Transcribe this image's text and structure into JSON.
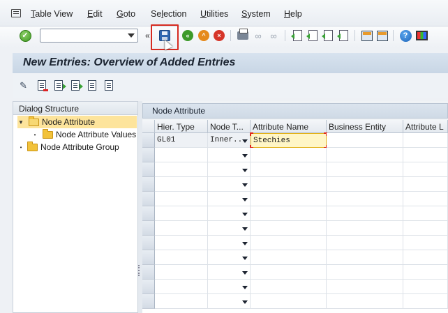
{
  "menubar": {
    "items": [
      {
        "label": "Table View",
        "u": "T",
        "rest": "able View"
      },
      {
        "label": "Edit",
        "u": "E",
        "rest": "dit"
      },
      {
        "label": "Goto",
        "u": "G",
        "rest": "oto"
      },
      {
        "label": "Selection",
        "pre": "Se",
        "u": "l",
        "rest": "ection"
      },
      {
        "label": "Utilities",
        "u": "U",
        "rest": "tilities"
      },
      {
        "label": "System",
        "u": "S",
        "rest": "ystem"
      },
      {
        "label": "Help",
        "u": "H",
        "rest": "elp"
      }
    ]
  },
  "toolbar": {
    "command_field_value": "",
    "icons": [
      "enter-check-icon",
      "save-icon",
      "back-icon",
      "exit-icon",
      "cancel-icon",
      "print-icon",
      "find-icon",
      "find-next-icon",
      "first-page-icon",
      "previous-page-icon",
      "next-page-icon",
      "last-page-icon",
      "create-session-icon",
      "shortcut-icon",
      "help-icon",
      "customize-layout-icon"
    ],
    "highlight_color": "#d62a20"
  },
  "title": "New Entries: Overview of Added Entries",
  "dialog_structure": {
    "header": "Dialog Structure",
    "items": [
      {
        "label": "Node Attribute",
        "level": 0,
        "expanded": true,
        "selected": true
      },
      {
        "label": "Node Attribute Values",
        "level": 1,
        "expanded": false,
        "selected": false
      },
      {
        "label": "Node Attribute Group",
        "level": 0,
        "expanded": false,
        "selected": false
      }
    ]
  },
  "table": {
    "title": "Node Attribute",
    "columns": [
      "Hier. Type",
      "Node T...",
      "Attribute Name",
      "Business Entity",
      "Attribute L"
    ],
    "rows": [
      [
        "GL01",
        "Inner...",
        "Stechies",
        "",
        ""
      ]
    ],
    "empty_rows": 11,
    "colors": {
      "edit_fill": "#fff6c6",
      "selected_tree": "#fde49c"
    }
  }
}
